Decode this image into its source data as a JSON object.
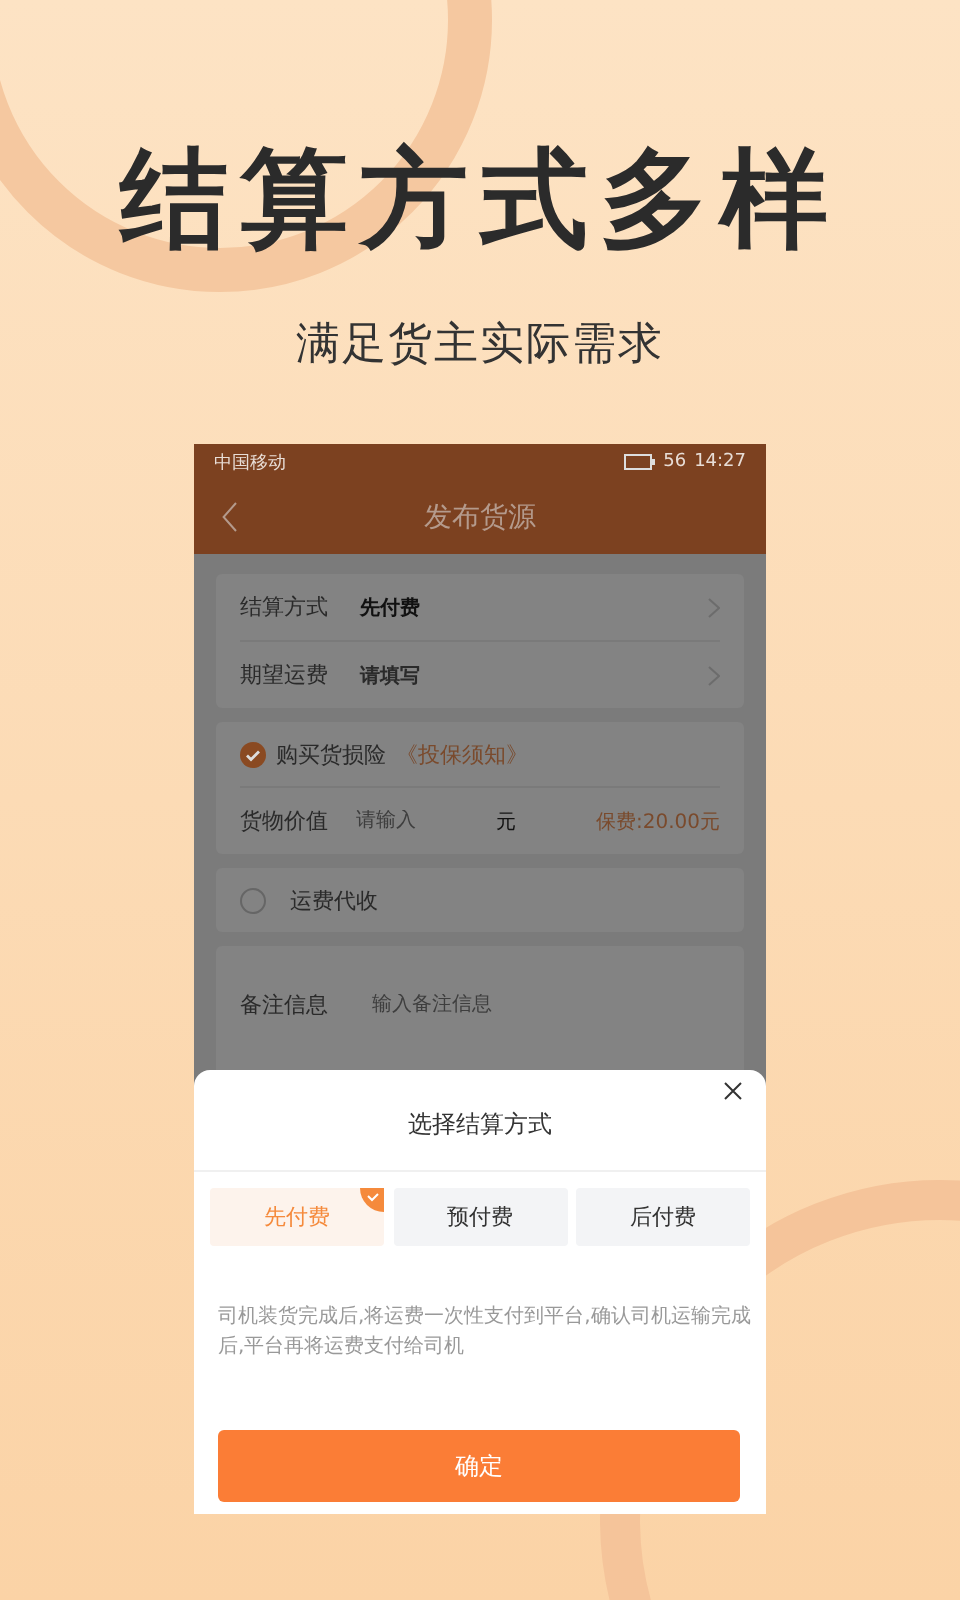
{
  "headline": "结算方式多样",
  "subtitle": "满足货主实际需求",
  "status_bar": {
    "carrier": "中国移动",
    "battery": "56",
    "time": "14:27"
  },
  "nav": {
    "title": "发布货源"
  },
  "settlement_card": {
    "rows": [
      {
        "label": "结算方式",
        "value": "先付费",
        "filled": true
      },
      {
        "label": "期望运费",
        "value": "请填写",
        "filled": false
      }
    ]
  },
  "insurance": {
    "checked": true,
    "label": "购买货损险",
    "link": "《投保须知》",
    "value_label": "货物价值",
    "placeholder": "请输入",
    "unit": "元",
    "fee": "保费:20.00元"
  },
  "freight_collect": {
    "checked": false,
    "label": "运费代收"
  },
  "remark": {
    "label": "备注信息",
    "placeholder": "输入备注信息"
  },
  "sheet": {
    "title": "选择结算方式",
    "options": [
      {
        "label": "先付费",
        "selected": true
      },
      {
        "label": "预付费",
        "selected": false
      },
      {
        "label": "后付费",
        "selected": false
      }
    ],
    "description": "司机装货完成后,将运费一次性支付到平台,确认司机运输完成后,平台再将运费支付给司机",
    "confirm": "确定"
  }
}
